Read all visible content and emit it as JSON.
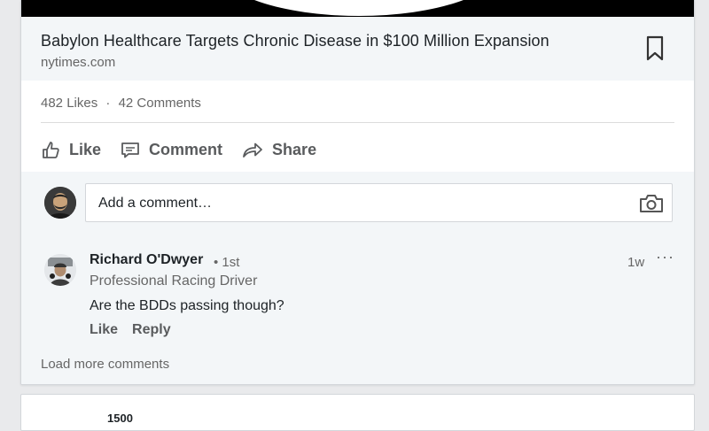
{
  "article": {
    "title": "Babylon Healthcare Targets Chronic Disease in $100 Million Expansion",
    "source": "nytimes.com"
  },
  "social": {
    "likes": "482 Likes",
    "separator": "·",
    "comments": "42 Comments"
  },
  "actions": {
    "like": "Like",
    "comment": "Comment",
    "share": "Share"
  },
  "comment_input": {
    "placeholder": "Add a comment…"
  },
  "comment": {
    "author": "Richard O'Dwyer",
    "degree": "• 1st",
    "headline": "Professional Racing Driver",
    "text": "Are the BDDs passing though?",
    "like": "Like",
    "reply": "Reply",
    "time": "1w",
    "more": "···"
  },
  "load_more": "Load more comments",
  "next_card": {
    "peek_text": "1500"
  },
  "colors": {
    "background": "#e9eaec",
    "card": "#ffffff",
    "panel": "#f3f6f8",
    "text_primary": "#1d2226",
    "text_secondary": "#666666"
  }
}
